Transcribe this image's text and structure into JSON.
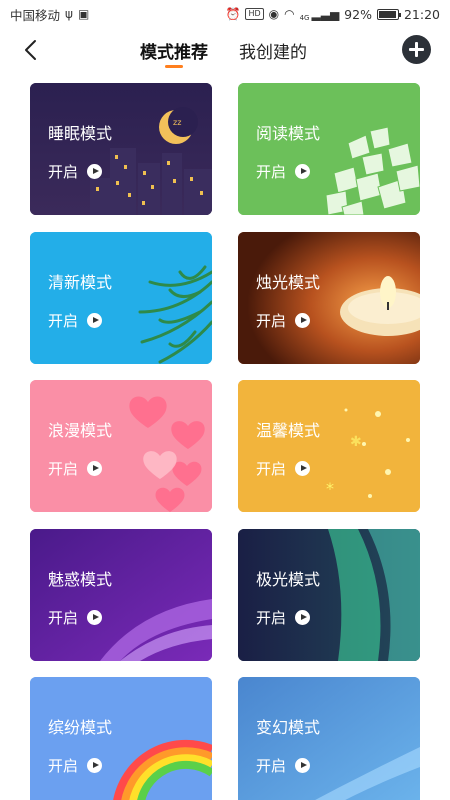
{
  "status_bar": {
    "carrier": "中国移动",
    "signal_badge": "HD",
    "network": "4G",
    "battery": "92%",
    "battery_level": 0.92,
    "time": "21:20"
  },
  "header": {
    "tabs": [
      {
        "label": "模式推荐",
        "active": true
      },
      {
        "label": "我创建的",
        "active": false
      }
    ],
    "accent_color": "#ff7f1e"
  },
  "open_label": "开启",
  "cards": [
    {
      "title": "睡眠模式",
      "theme": "night-city-moon",
      "color": "#2a1f4a"
    },
    {
      "title": "阅读模式",
      "theme": "flying-books",
      "color": "#6cc05a"
    },
    {
      "title": "清新模式",
      "theme": "palm-leaves",
      "color": "#23aee8"
    },
    {
      "title": "烛光模式",
      "theme": "candle",
      "color": "#b24a1c"
    },
    {
      "title": "浪漫模式",
      "theme": "hearts",
      "color": "#fa8fa6"
    },
    {
      "title": "温馨模式",
      "theme": "sparkles",
      "color": "#f2b43c"
    },
    {
      "title": "魅惑模式",
      "theme": "purple-wave",
      "color": "#5a1fa0"
    },
    {
      "title": "极光模式",
      "theme": "aurora",
      "color": "#1a2a4a"
    },
    {
      "title": "缤纷模式",
      "theme": "rainbow",
      "color": "#6ba0f0"
    },
    {
      "title": "变幻模式",
      "theme": "blue-wave",
      "color": "#5a9ad8"
    }
  ]
}
